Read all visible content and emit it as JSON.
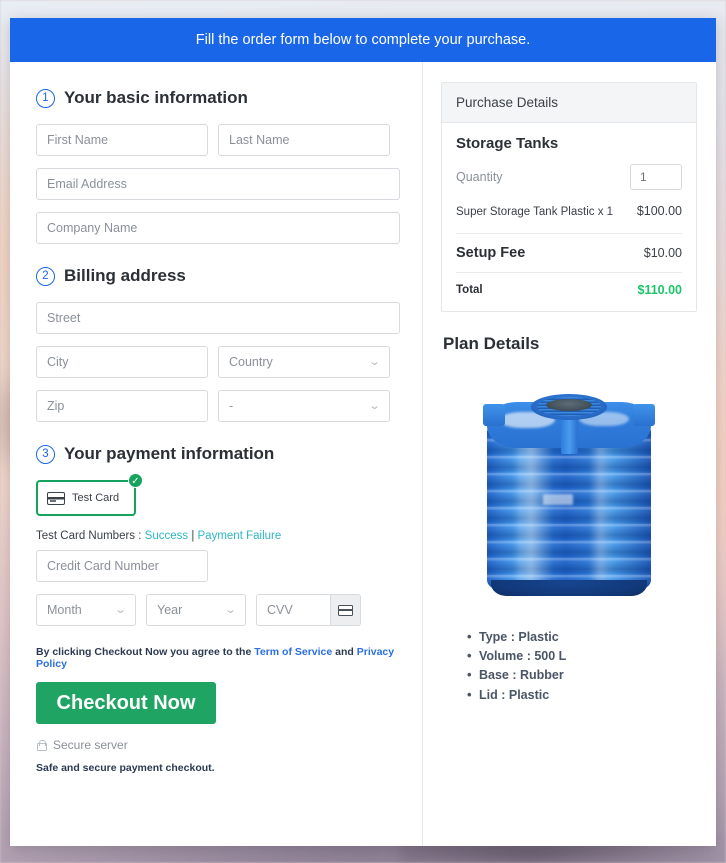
{
  "banner": {
    "text": "Fill the order form below to complete your purchase."
  },
  "sections": {
    "basic": {
      "num": "1",
      "title": "Your basic information"
    },
    "billing": {
      "num": "2",
      "title": "Billing address"
    },
    "payment": {
      "num": "3",
      "title": "Your payment information"
    }
  },
  "fields": {
    "first_name": "First Name",
    "last_name": "Last Name",
    "email": "Email Address",
    "company": "Company Name",
    "street": "Street",
    "city": "City",
    "country": "Country",
    "zip": "Zip",
    "state": "-",
    "credit_card": "Credit Card Number",
    "month": "Month",
    "year": "Year",
    "cvv": "CVV"
  },
  "payment": {
    "method_label": "Test  Card",
    "method_selected": true,
    "check_glyph": "✓",
    "testcards_prefix": "Test Card Numbers : ",
    "link_success": "Success",
    "separator": " | ",
    "link_failure": "Payment Failure",
    "link_color": "#2eb6c4"
  },
  "terms": {
    "prefix": "By clicking Checkout Now you agree to the ",
    "tos": "Term of Service",
    "conj": " and ",
    "privacy": "Privacy Policy"
  },
  "checkout": {
    "button_label": "Checkout Now",
    "button_color": "#1fa463",
    "secure_label": "Secure server",
    "safe_note": "Safe and secure payment checkout."
  },
  "purchase": {
    "panel_title": "Purchase Details",
    "product_title": "Storage Tanks",
    "quantity_label": "Quantity",
    "quantity_value": "1",
    "line_item_name": "Super Storage Tank Plastic x 1",
    "line_item_amount": "$100.00",
    "setup_fee_label": "Setup Fee",
    "setup_fee_amount": "$10.00",
    "total_label": "Total",
    "total_amount": "$110.00",
    "total_color": "#1ec46a"
  },
  "plan": {
    "title": "Plan Details",
    "image_alt": "blue-plastic-water-storage-tank",
    "specs": [
      "Type : Plastic",
      "Volume : 500 L",
      "Base : Rubber",
      "Lid : Plastic"
    ]
  },
  "theme": {
    "banner_blue": "#1a66e8",
    "accent_blue": "#2a6fe0",
    "green": "#16a35c"
  }
}
